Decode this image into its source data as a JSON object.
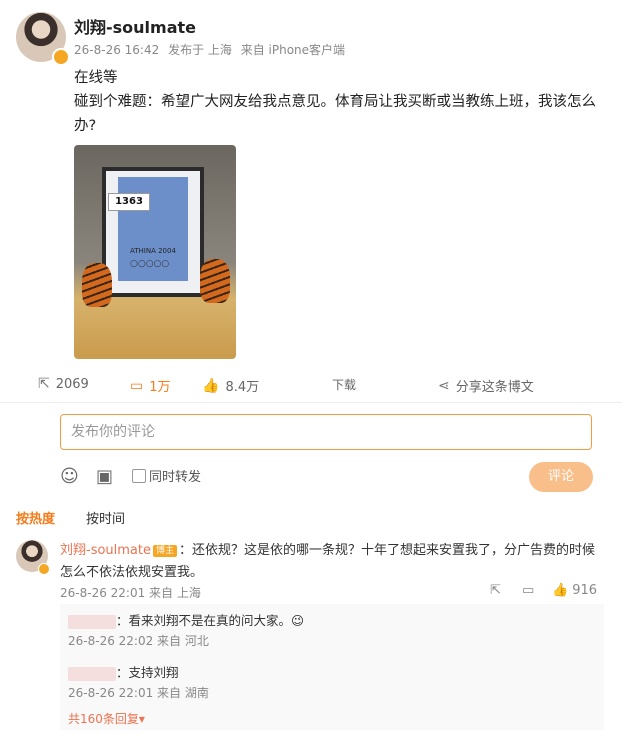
{
  "post": {
    "username": "刘翔-soulmate",
    "time": "26-8-26 16:42",
    "location": "发布于 上海",
    "source": "来自 iPhone客户端",
    "line1": "在线等",
    "line2": "碰到个难题：希望广大网友给我点意见。体育局让我买断或当教练上班，我该怎么",
    "line3": "办?",
    "photo": {
      "bib_number": "1363",
      "poster_text": "ATHINA 2004",
      "rings": "○○○○○"
    }
  },
  "stats": {
    "repost": "2069",
    "comments": "1万",
    "likes": "8.4万",
    "download": "下载",
    "share": "分享这条博文",
    "icons": [
      "share-out-icon",
      "comment-icon",
      "thumb-up-icon",
      "share-nodes-icon"
    ]
  },
  "composer": {
    "placeholder": "发布你的评论",
    "repost_label": "同时转发",
    "submit": "评论",
    "icons": [
      "emoji-icon",
      "image-icon"
    ]
  },
  "tabs": {
    "hot": "按热度",
    "time": "按时间"
  },
  "comment": {
    "username": "刘翔-soulmate",
    "badge": "博主",
    "text": "：还依规？这是依的哪一条规？十年了想起来安置我了，分广告费的时候怎么不依法依规安置我。",
    "time": "26-8-26 22:01 来自 上海",
    "likes": "916"
  },
  "replies": [
    {
      "text": "：看来刘翔不是在真的问大家。😉",
      "time": "26-8-26 22:02 来自 河北"
    },
    {
      "text": "：支持刘翔",
      "time": "26-8-26 22:01 来自 湖南"
    }
  ],
  "more_replies": "共160条回复▾",
  "colors": {
    "accent": "#f77b1a",
    "name": "#eb7350",
    "button": "#f9bf8b"
  }
}
